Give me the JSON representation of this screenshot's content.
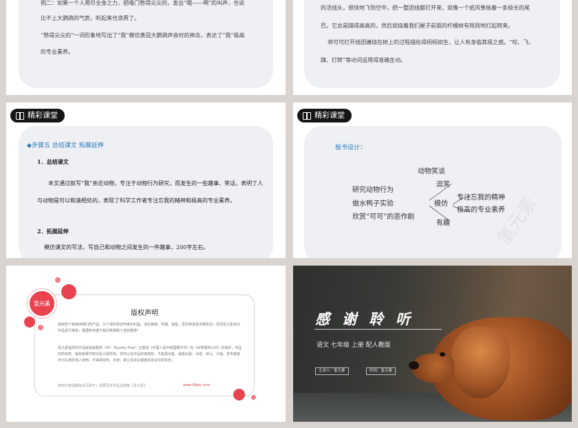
{
  "slide1": {
    "p1": "例二：如果一个人用尽全身之力，把嗓门憋得尖尖的，发出“哦——啊”的叫声，也说",
    "p2": "比不上大鹦鹉的气势，听起来也浪费了。",
    "p3": "“憋得尖尖的”一词形象地写出了“我”模仿黄冠大鹦鹉声音时的神态，表达了“我”极高",
    "p4": "的专业素养。"
  },
  "slide2": {
    "p1": "的活线头，很快地飞到空中，把一整团线都打开来，就像一个纸风筝拖着一条极长的尾",
    "p2": "巴。它总是蹿得高高的，然后就绕着我们屋子前面的柠檬树有规则地打起转来。",
    "p3": "将可可打开线团缠绕在树上的过程描绘得栩栩如生，让人有身临其境之感。“咬、飞、",
    "p4": "蹿、打转”等动词运用得准确生动。"
  },
  "slide3": {
    "tag": "精彩课堂",
    "step": "◆步骤五  总结课文  拓展延伸",
    "h1": "1．总结课文",
    "b1": "本文通过叙写“我”亲近动物，专注于动物行为研究，而发生的一些趣事、笑话，表明了人与动物是可以和谐相处的，表现了科学工作者专注忘我的精神和极高的专业素养。",
    "h2": "2．拓展延伸",
    "b2": "模仿课文的写法，写自己和动物之间发生的一件趣事，200字左右。"
  },
  "slide4": {
    "tag": "精彩课堂",
    "board_title": "板书设计：",
    "items": {
      "top": "动物笑谈",
      "left1": "研究动物行为",
      "left2": "做水鸭子实验",
      "left3": "欣赏“可可”的恶作剧",
      "mid1": "逗笑",
      "mid2": "模仿",
      "mid3": "有趣",
      "right1": "专注忘我的精神",
      "right2": "极高的专业素养"
    },
    "watermark": "氢元素"
  },
  "slide5": {
    "logo": "氢元素",
    "title": "版权声明",
    "text1": "感谢您下载使用我们的产品，为了保护原创作者的利益，请勿复制、传播、销售，否则将承担法律责任！否则氢元素将对作品进行维权，根据新传播下载次数索取十倍的赔偿！",
    "text2": "氢元素提供的作品版免版税类（RF：Royalty-Free）正版受《中国人民共和国著作法》和《世界版权公约》的保护，作品的所有权、版权和著作权归氢元素所有，您可以在作品的使用权，不能再出售、或者出租、出借、转让、分销、发布或者作为礼物供他人使用，不得转授权、出卖、转让本协议或者本协议中的权利。",
    "footer": "使用中若提删除本页即可！需要更多作品请搜索【氢元素】",
    "link": "www.49pic.com"
  },
  "slide6": {
    "title": "感谢聆听",
    "subtitle": "语文 七年级 上册 配人教版",
    "presenter": "主讲人：氢元素",
    "time": "时间：氢元素"
  }
}
